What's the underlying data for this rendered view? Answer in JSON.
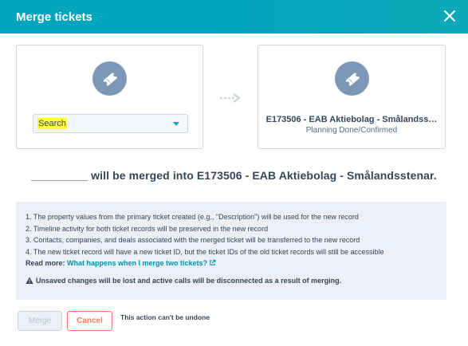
{
  "dialog": {
    "title": "Merge tickets",
    "close_icon": "close-icon"
  },
  "left_card": {
    "icon": "ticket-icon",
    "search": {
      "value": "Search",
      "highlight_color": "#ffff33"
    }
  },
  "right_card": {
    "icon": "ticket-icon",
    "title": "E173506 - EAB Aktiebolag - Smålandss…",
    "status": "Planning Done/Confirmed"
  },
  "summary": "_________ will be merged into E173506 - EAB Aktiebolag - Smålandsstenar.",
  "info": {
    "lines": [
      "1. The property values from the primary ticket created (e.g., \"Description\") will be used for the new record",
      "2. Timeline activity for both ticket records will be preserved in the new record",
      "3. Contacts, companies, and deals associated with the merged ticket will be transferred to the new record",
      "4. The new ticket record will have a new ticket ID, but the ticket IDs of the old ticket records will still be accessible"
    ],
    "read_more_label": "Read more:",
    "read_more_link": "What happens when I merge two tickets?",
    "warning": "Unsaved changes will be lost and active calls will be disconnected as a result of merging."
  },
  "footer": {
    "merge_label": "Merge",
    "cancel_label": "Cancel",
    "note": "This action can't be undone"
  },
  "colors": {
    "header": "#00a4bd",
    "icon_circle": "#7c98b6",
    "link": "#0091ae",
    "cancel": "#ff7a59"
  }
}
